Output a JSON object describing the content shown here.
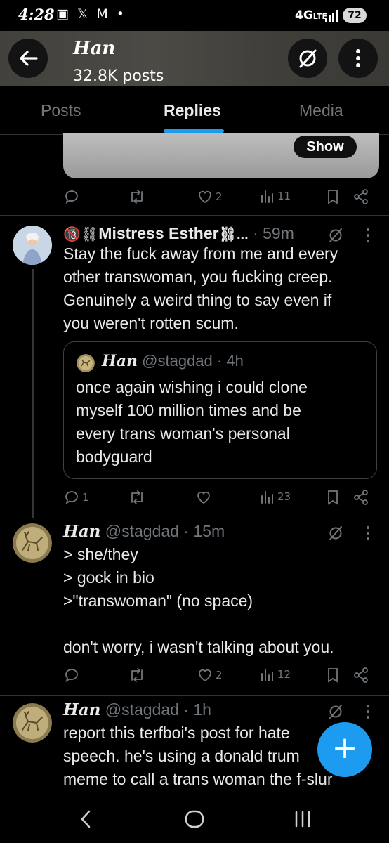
{
  "status_bar": {
    "time": "4:28",
    "icons_text": "▣ 𝕏 M •",
    "network": "4G",
    "network_sub": "LTE",
    "battery": "72"
  },
  "header": {
    "name": "Han",
    "posts": "32.8K posts"
  },
  "tabs": [
    {
      "label": "Posts"
    },
    {
      "label": "Replies",
      "active": true
    },
    {
      "label": "Media"
    }
  ],
  "top_post": {
    "show_label": "Show",
    "likes": "2",
    "views": "11"
  },
  "tweets": [
    {
      "emoji_prefix": "🔞",
      "chain_left": "⛓",
      "display_name": "Mistress Esther",
      "chain_right": "⛓...",
      "time": "· 59m",
      "lines": [
        "Stay the fuck away from me and every",
        "other transwoman, you fucking creep.",
        "Genuinely a weird thing to say even if",
        "you weren't rotten scum."
      ],
      "quote": {
        "display_name": "Han",
        "handle": "@stagdad",
        "time": "· 4h",
        "lines": [
          "once again wishing i could clone",
          "myself 100 million times and be",
          "every trans woman's personal",
          "bodyguard"
        ]
      },
      "replies": "1",
      "views": "23"
    },
    {
      "display_name": "Han",
      "handle": "@stagdad",
      "time": "· 15m",
      "lines": [
        "> she/they",
        "> gock in bio",
        ">\"transwoman\" (no space)",
        "",
        "don't worry, i wasn't talking about you."
      ],
      "likes": "2",
      "views": "12"
    },
    {
      "display_name": "Han",
      "handle": "@stagdad",
      "time": "· 1h",
      "lines": [
        "report this terfboi's post for hate",
        "speech. he's using a donald trum",
        "meme to call a trans woman the f-slur"
      ]
    }
  ],
  "fab": {
    "label": "+"
  },
  "colors": {
    "accent": "#1d9bf0",
    "muted": "#71767b",
    "text": "#e7e9ea",
    "bg": "#000000"
  }
}
